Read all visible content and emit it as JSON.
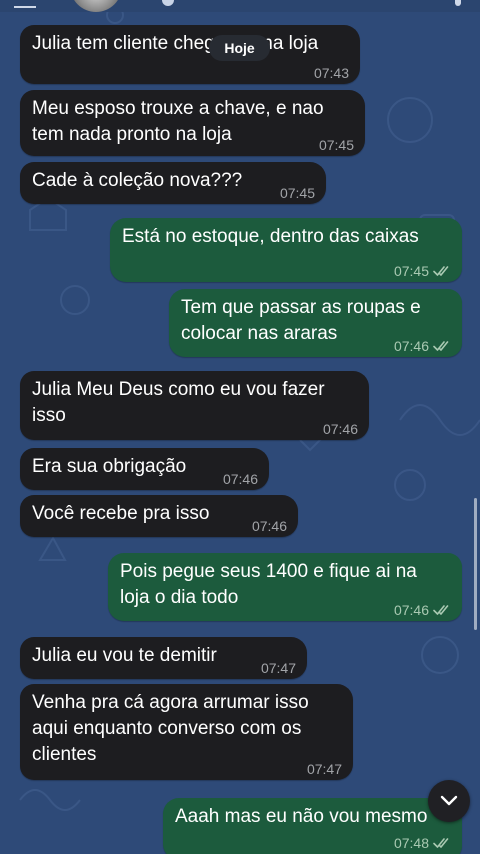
{
  "date_separator": "Hoje",
  "messages": [
    {
      "dir": "in",
      "text": "Julia tem cliente chegando na loja",
      "time": "07:43"
    },
    {
      "dir": "in",
      "text": "Meu esposo trouxe a chave, e nao\ntem nada pronto na loja",
      "time": "07:45"
    },
    {
      "dir": "in",
      "text": "Cade à coleção nova???",
      "time": "07:45"
    },
    {
      "dir": "out",
      "text": "Está no estoque, dentro das caixas",
      "time": "07:45"
    },
    {
      "dir": "out",
      "text": "Tem que passar as roupas e\ncolocar nas araras",
      "time": "07:46"
    },
    {
      "dir": "in",
      "text": "Julia Meu Deus como eu vou fazer\nisso",
      "time": "07:46"
    },
    {
      "dir": "in",
      "text": "Era sua obrigação",
      "time": "07:46"
    },
    {
      "dir": "in",
      "text": "Você recebe pra isso",
      "time": "07:46"
    },
    {
      "dir": "out",
      "text": "Pois pegue seus 1400 e fique ai na\nloja o dia todo",
      "time": "07:46"
    },
    {
      "dir": "in",
      "text": "Julia eu vou te demitir",
      "time": "07:47"
    },
    {
      "dir": "in",
      "text": "Venha pra cá agora arrumar isso\naqui enquanto converso com os\nclientes",
      "time": "07:47"
    },
    {
      "dir": "out",
      "text": "Aaah mas eu não vou mesmo",
      "time": "07:48"
    }
  ],
  "icons": {
    "read_receipt": "double-check-icon",
    "scroll_down": "chevron-down-icon"
  },
  "colors": {
    "background": "#2e4a78",
    "incoming_bubble": "#1d1d20",
    "outgoing_bubble": "#1c5b3d"
  }
}
